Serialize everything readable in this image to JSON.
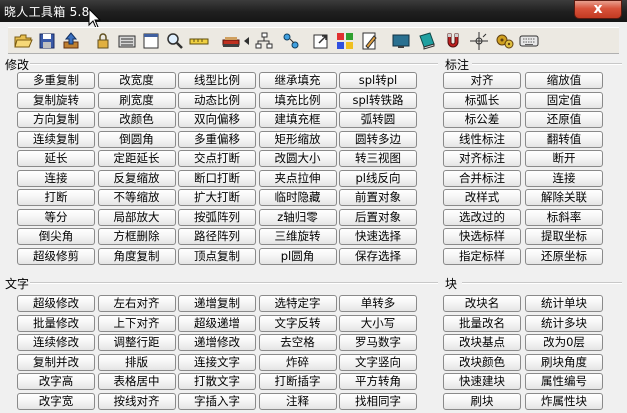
{
  "window": {
    "title": "晓人工具箱 5.8",
    "close_label": "x"
  },
  "toolbar": {
    "buttons": [
      "open-folder-icon",
      "save-icon",
      "upload-icon",
      "lock-icon",
      "layers-icon",
      "window-icon",
      "zoom-icon",
      "ruler-icon",
      "book-icon",
      "arrow-left-icon",
      "tree-icon",
      "sort-icon",
      "external-link-icon",
      "palette-icon",
      "edit-icon",
      "monitor-icon",
      "notebook-icon",
      "magnet-icon",
      "crosshair-icon",
      "gears-icon",
      "keyboard-icon"
    ]
  },
  "sections": {
    "modify": {
      "title": "修改",
      "rows": [
        [
          "多重复制",
          "改宽度",
          "线型比例",
          "继承填充",
          "spl转pl"
        ],
        [
          "复制旋转",
          "刷宽度",
          "动态比例",
          "填充比例",
          "spl转铁路"
        ],
        [
          "方向复制",
          "改颜色",
          "双向偏移",
          "建填充框",
          "弧转圆"
        ],
        [
          "连续复制",
          "倒圆角",
          "多重偏移",
          "矩形缩放",
          "圆转多边"
        ],
        [
          "延长",
          "定距延长",
          "交点打断",
          "改圆大小",
          "转三视图"
        ],
        [
          "连接",
          "反复缩放",
          "断口打断",
          "夹点拉伸",
          "pl线反向"
        ],
        [
          "打断",
          "不等缩放",
          "扩大打断",
          "临时隐藏",
          "前置对象"
        ],
        [
          "等分",
          "局部放大",
          "按弧阵列",
          "z轴归零",
          "后置对象"
        ],
        [
          "倒尖角",
          "方框删除",
          "路径阵列",
          "三维旋转",
          "快速选择"
        ],
        [
          "超级修剪",
          "角度复制",
          "顶点复制",
          "pl圆角",
          "保存选择"
        ]
      ]
    },
    "annotate": {
      "title": "标注",
      "rows": [
        [
          "对齐",
          "缩放值"
        ],
        [
          "标弧长",
          "固定值"
        ],
        [
          "标公差",
          "还原值"
        ],
        [
          "线性标注",
          "翻转值"
        ],
        [
          "对齐标注",
          "断开"
        ],
        [
          "合并标注",
          "连接"
        ],
        [
          "改样式",
          "解除关联"
        ],
        [
          "选改过的",
          "标斜率"
        ],
        [
          "快选标样",
          "提取坐标"
        ],
        [
          "指定标样",
          "还原坐标"
        ]
      ]
    },
    "text": {
      "title": "文字",
      "rows": [
        [
          "超级修改",
          "左右对齐",
          "递增复制",
          "选特定字",
          "单转多"
        ],
        [
          "批量修改",
          "上下对齐",
          "超级递增",
          "文字反转",
          "大小写"
        ],
        [
          "连续修改",
          "调整行距",
          "递增修改",
          "去空格",
          "罗马数字"
        ],
        [
          "复制并改",
          "排版",
          "连接文字",
          "炸碎",
          "文字竖向"
        ],
        [
          "改字高",
          "表格居中",
          "打散文字",
          "打断插字",
          "平方转角"
        ],
        [
          "改字宽",
          "按线对齐",
          "字插入字",
          "注释",
          "找相同字"
        ]
      ]
    },
    "block": {
      "title": "块",
      "rows": [
        [
          "改块名",
          "统计单块"
        ],
        [
          "批量改名",
          "统计多块"
        ],
        [
          "改块基点",
          "改为0层"
        ],
        [
          "改块颜色",
          "刷块角度"
        ],
        [
          "快速建块",
          "属性编号"
        ],
        [
          "刷块",
          "炸属性块"
        ]
      ]
    }
  },
  "colors": {
    "titlebar": "#1f1f1f",
    "window_bg": "#f0f0f0",
    "close_button": "#d8523a"
  }
}
